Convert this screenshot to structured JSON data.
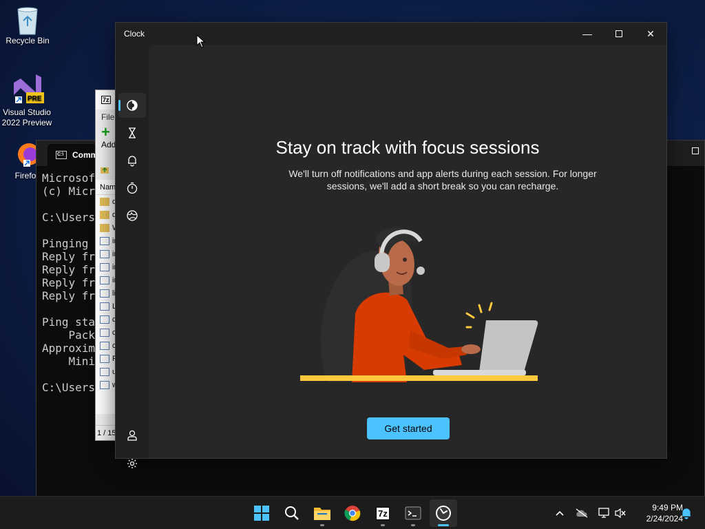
{
  "desktop": {
    "icons": [
      {
        "label": "Recycle Bin"
      },
      {
        "label": "Visual Studio 2022 Preview",
        "badge": "PRE"
      },
      {
        "label": "Firefox"
      }
    ]
  },
  "cmd": {
    "tab_title": "Comma",
    "lines": [
      "Microsoft",
      "(c) Micro",
      "",
      "C:\\Users\\",
      "",
      "Pinging c",
      "Reply fro",
      "Reply fro",
      "Reply fro",
      "Reply fro",
      "",
      "Ping stat",
      "    Packe",
      "Approxima",
      "    Minim",
      "",
      "C:\\Users\\"
    ]
  },
  "sevenzip": {
    "logo": "7z",
    "menu_file": "File",
    "toolbar_add": "Add",
    "col_name": "Nam",
    "rows": [
      "d",
      "d",
      "W",
      "ir",
      "ir",
      "ir",
      "ir",
      "li",
      "L",
      "c",
      "c",
      "c",
      "R",
      "u",
      "w"
    ],
    "status": "1 / 15"
  },
  "clock": {
    "title": "Clock",
    "nav": [
      "focus-sessions",
      "timer",
      "alarm",
      "stopwatch",
      "world-clock",
      "account",
      "settings"
    ],
    "headline": "Stay on track with focus sessions",
    "subtext": "We'll turn off notifications and app alerts during each session. For longer sessions, we'll add a short break so you can recharge.",
    "button": "Get started",
    "accent": "#4cc2ff"
  },
  "taskbar": {
    "apps": [
      "start",
      "search",
      "file-explorer",
      "chrome",
      "7-zip",
      "terminal",
      "clock"
    ],
    "active_app": "clock",
    "sevenzip_label": "7z",
    "time": "9:49 PM",
    "date": "2/24/2024"
  }
}
